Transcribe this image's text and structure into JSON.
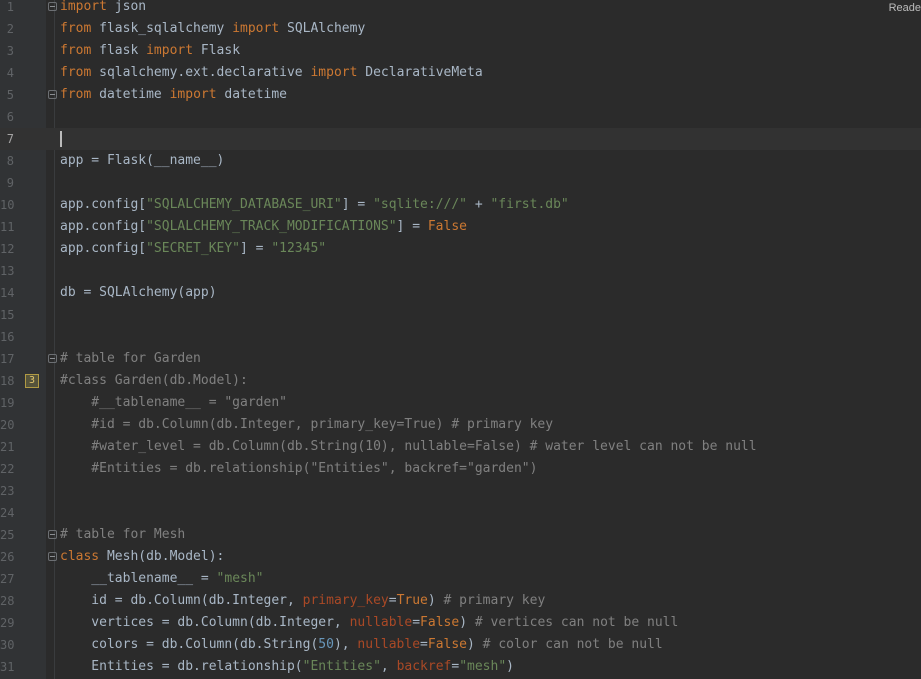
{
  "status": {
    "readonly_label": "Reade"
  },
  "gutter": {
    "annotation_badge": "3"
  },
  "lines": [
    {
      "n": "1",
      "t": [
        {
          "k": "kw",
          "v": "import"
        },
        {
          "k": "p",
          "v": " json"
        }
      ]
    },
    {
      "n": "2",
      "t": [
        {
          "k": "kw",
          "v": "from"
        },
        {
          "k": "p",
          "v": " flask_sqlalchemy "
        },
        {
          "k": "kw",
          "v": "import"
        },
        {
          "k": "p",
          "v": " SQLAlchemy"
        }
      ]
    },
    {
      "n": "3",
      "t": [
        {
          "k": "kw",
          "v": "from"
        },
        {
          "k": "p",
          "v": " flask "
        },
        {
          "k": "kw",
          "v": "import"
        },
        {
          "k": "p",
          "v": " Flask"
        }
      ]
    },
    {
      "n": "4",
      "t": [
        {
          "k": "kw",
          "v": "from"
        },
        {
          "k": "p",
          "v": " sqlalchemy.ext.declarative "
        },
        {
          "k": "kw",
          "v": "import"
        },
        {
          "k": "p",
          "v": " DeclarativeMeta"
        }
      ]
    },
    {
      "n": "5",
      "t": [
        {
          "k": "kw",
          "v": "from"
        },
        {
          "k": "p",
          "v": " datetime "
        },
        {
          "k": "kw",
          "v": "import"
        },
        {
          "k": "p",
          "v": " datetime"
        }
      ]
    },
    {
      "n": "6",
      "t": []
    },
    {
      "n": "7",
      "t": []
    },
    {
      "n": "8",
      "t": [
        {
          "k": "p",
          "v": "app = Flask(__name__)"
        }
      ]
    },
    {
      "n": "9",
      "t": []
    },
    {
      "n": "10",
      "t": [
        {
          "k": "p",
          "v": "app.config["
        },
        {
          "k": "str",
          "v": "\"SQLALCHEMY_DATABASE_URI\""
        },
        {
          "k": "p",
          "v": "] = "
        },
        {
          "k": "str",
          "v": "\"sqlite:///\""
        },
        {
          "k": "p",
          "v": " + "
        },
        {
          "k": "str",
          "v": "\"first.db\""
        }
      ]
    },
    {
      "n": "11",
      "t": [
        {
          "k": "p",
          "v": "app.config["
        },
        {
          "k": "str",
          "v": "\"SQLALCHEMY_TRACK_MODIFICATIONS\""
        },
        {
          "k": "p",
          "v": "] = "
        },
        {
          "k": "kw",
          "v": "False"
        }
      ]
    },
    {
      "n": "12",
      "t": [
        {
          "k": "p",
          "v": "app.config["
        },
        {
          "k": "str",
          "v": "\"SECRET_KEY\""
        },
        {
          "k": "p",
          "v": "] = "
        },
        {
          "k": "str",
          "v": "\"12345\""
        }
      ]
    },
    {
      "n": "13",
      "t": []
    },
    {
      "n": "14",
      "t": [
        {
          "k": "p",
          "v": "db = SQLAlchemy(app)"
        }
      ]
    },
    {
      "n": "15",
      "t": []
    },
    {
      "n": "16",
      "t": []
    },
    {
      "n": "17",
      "t": [
        {
          "k": "cm",
          "v": "# table for Garden"
        }
      ]
    },
    {
      "n": "18",
      "t": [
        {
          "k": "cm",
          "v": "#class Garden(db.Model):"
        }
      ]
    },
    {
      "n": "19",
      "t": [
        {
          "k": "cm",
          "v": "    #__tablename__ = \"garden\""
        }
      ]
    },
    {
      "n": "20",
      "t": [
        {
          "k": "cm",
          "v": "    #id = db.Column(db.Integer, primary_key=True) # primary key"
        }
      ]
    },
    {
      "n": "21",
      "t": [
        {
          "k": "cm",
          "v": "    #water_level = db.Column(db.String(10), nullable=False) # water level can not be null"
        }
      ]
    },
    {
      "n": "22",
      "t": [
        {
          "k": "cm",
          "v": "    #Entities = db.relationship(\"Entities\", backref=\"garden\")"
        }
      ]
    },
    {
      "n": "23",
      "t": []
    },
    {
      "n": "24",
      "t": []
    },
    {
      "n": "25",
      "t": [
        {
          "k": "cm",
          "v": "# table for Mesh"
        }
      ]
    },
    {
      "n": "26",
      "t": [
        {
          "k": "kw",
          "v": "class"
        },
        {
          "k": "p",
          "v": " Mesh(db.Model):"
        }
      ]
    },
    {
      "n": "27",
      "t": [
        {
          "k": "p",
          "v": "    __tablename__ = "
        },
        {
          "k": "str",
          "v": "\"mesh\""
        }
      ]
    },
    {
      "n": "28",
      "t": [
        {
          "k": "p",
          "v": "    id = db.Column(db.Integer, "
        },
        {
          "k": "param",
          "v": "primary_key"
        },
        {
          "k": "p",
          "v": "="
        },
        {
          "k": "kw",
          "v": "True"
        },
        {
          "k": "p",
          "v": ") "
        },
        {
          "k": "cm",
          "v": "# primary key"
        }
      ]
    },
    {
      "n": "29",
      "t": [
        {
          "k": "p",
          "v": "    vertices = db.Column(db.Integer, "
        },
        {
          "k": "param",
          "v": "nullable"
        },
        {
          "k": "p",
          "v": "="
        },
        {
          "k": "kw",
          "v": "False"
        },
        {
          "k": "p",
          "v": ") "
        },
        {
          "k": "cm",
          "v": "# vertices can not be null"
        }
      ]
    },
    {
      "n": "30",
      "t": [
        {
          "k": "p",
          "v": "    colors = db.Column(db.String("
        },
        {
          "k": "num",
          "v": "50"
        },
        {
          "k": "p",
          "v": "), "
        },
        {
          "k": "param",
          "v": "nullable"
        },
        {
          "k": "p",
          "v": "="
        },
        {
          "k": "kw",
          "v": "False"
        },
        {
          "k": "p",
          "v": ") "
        },
        {
          "k": "cm",
          "v": "# color can not be null"
        }
      ]
    },
    {
      "n": "31",
      "t": [
        {
          "k": "p",
          "v": "    Entities = db.relationship("
        },
        {
          "k": "str",
          "v": "\"Entities\""
        },
        {
          "k": "p",
          "v": ", "
        },
        {
          "k": "param",
          "v": "backref"
        },
        {
          "k": "p",
          "v": "="
        },
        {
          "k": "str",
          "v": "\"mesh\""
        },
        {
          "k": "p",
          "v": ")"
        }
      ]
    }
  ],
  "colors": {
    "background": "#2b2b2b",
    "gutter": "#313335",
    "keyword": "#cc7832",
    "string": "#6a8759",
    "comment": "#808080",
    "number": "#6897bb",
    "parameter": "#aa4926",
    "plain": "#a9b7c6"
  }
}
